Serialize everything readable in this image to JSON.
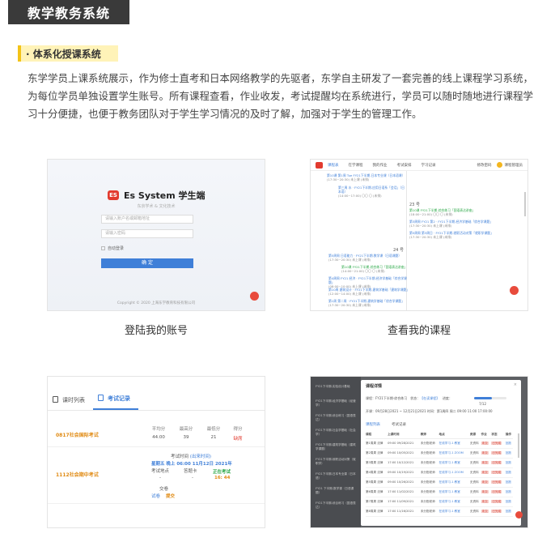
{
  "page": {
    "title": "教学教务系统",
    "section_title": "· 体系化授课系统",
    "intro": "东学学员上课系统展示，作为修士直考和日本网络教学的先驱者，东学自主研发了一套完善的线上课程学习系统，为每位学员单独设置学生账号。所有课程查看，作业收发，考试提醒均在系统进行，学员可以随时随地进行课程学习十分便捷，也便于教务团队对于学生学习情况的及时了解，加强对于学生的管理工作。"
  },
  "captions": {
    "login": "登陆我的账号",
    "course": "查看我的课程"
  },
  "login_shot": {
    "logo_text": "ES",
    "brand": "Es System 学生端",
    "subtitle": "东京学术 & 文化技术",
    "username_placeholder": "请输入账户名或邮箱地址",
    "password_placeholder": "请输入密码",
    "remember": "自动登录",
    "login_button": "确 定",
    "footer": "Copyright © 2020 上海东学教育科技有限公司"
  },
  "course_shot": {
    "nav": [
      "课程表",
      "在学课程",
      "我的作业",
      "考试安排",
      "学习记录"
    ],
    "nav_right": "修改密码",
    "user": "课程管理员",
    "events_left": [
      {
        "title": "第10课 第1周 Tue FY21下半期-日本专业课（日本语课）",
        "time": "(17:30~20:30) 未上课 (未排)"
      },
      {
        "title": "第三周 水 ‧ FY21下半期-应用日语系「会话」（日本语）",
        "time": "(14:00~17:00) 〇〇 〇 (未排)"
      }
    ],
    "day_23": "23 号",
    "events_23": [
      {
        "title": "第10课 FY21下半期-综合练习「国语表达讲座」",
        "time": "(18:00~21:00) 〇〇 〇 (未排)"
      },
      {
        "title": "第3周周 FY21 第2 ‧ FY21下半期-经济学基础「综合学课题」",
        "time": "(17:30~20:30) 未上课 (未排)"
      },
      {
        "title": "第5周周 第3周日 ‧ FY21下半期-就职活动对策「就职学课题」",
        "time": "(17:30~20:30) 未上课 (未排)"
      }
    ],
    "day_24": "24 号",
    "events_24": [
      {
        "title": "第5周周 日语能力 ‧ FY21下半期-数学课（日语课题）",
        "time": "(17:30~20:30) 未上课 (未排)"
      },
      {
        "title": "第10课 FY21下半期-综合练习「国语表达讲座」",
        "time": "(14:00~21:00) 〇〇 〇 (未排)"
      },
      {
        "title": "第4周周 FY21 经济 ‧ FY21下半期-经济学基础「综合学课题」",
        "time": "(08:00~10:00) 未上课 (未排)"
      },
      {
        "title": "第10周 建筑设计 ‧ FY21下半期-建筑学基础「建筑学课题」",
        "time": "(12:00~14:00) 未上课 (未排)"
      },
      {
        "title": "第1周 第二周 ‧ FY21下半期-建筑学基础「综合学课题」",
        "time": "(17:30~20:30) 未上课 (未排)"
      }
    ]
  },
  "records_shot": {
    "tabs": [
      "课时列表",
      "考试记录"
    ],
    "exam1": {
      "name": "0817社会国际考试",
      "avg_label": "平均分",
      "avg": "44.00",
      "max_label": "最高分",
      "max": "39",
      "min_label": "最低分",
      "min": "21",
      "score_label": "得分",
      "score": "缺席"
    },
    "exam2": {
      "name": "1112社会期中考试",
      "time_label": "考试时间",
      "time_status": "(出来时间)",
      "time_value": "星期五 晚上 06:00 11月12日 2021年",
      "place_label": "考试地点",
      "place_value": "-",
      "card_label": "答题卡",
      "card_value": "-",
      "status": "正在考试",
      "countdown": "16: 44",
      "paper_label": "交卷",
      "paper_value": "试卷",
      "submit": "提交"
    }
  },
  "schedule_shot": {
    "sidebar": [
      "FY21下半期-实验设计基础",
      "FY21下半期-经济学基础（经营学）",
      "FY21下半期-综合练习（国语表达）",
      "FY21下半期-社会学基础（社会学）",
      "FY21下半期-建筑学基础（建筑学课题）",
      "FY21下半期-就职活动对策（就职学）",
      "FY21下半期-日本专业课（日本语）",
      "FY21 下半期-数学课（日语课题）",
      "FY21下半期-综合练习（国语表达）"
    ],
    "modal_title": "课程详情",
    "close": "×",
    "info_line1_label": "课程：",
    "info_line1": "FY21下半期-综合练习",
    "info_status_label": "状态：",
    "info_status": "【在读课程】",
    "info_progress_label": "进度：",
    "info_progress": "7/12",
    "info_line2": "开课：09月28日2021 ~ 12月21日2021   时间：第1周四 周二 09:00 11:00 17:00:00",
    "tabs": [
      "课程列表",
      "考试记录"
    ],
    "columns": [
      "课程",
      "上课时间",
      "教师",
      "地点",
      "资源",
      "作业",
      "状态",
      "操作"
    ],
    "rows": [
      {
        "course": "第1周周 法律",
        "time": "09:00 09/28/2021",
        "teacher": "未分配老师",
        "place": "在线学习-1 教室",
        "res": "无资料",
        "hw": "未交",
        "state": "已完成",
        "op": "回放"
      },
      {
        "course": "第2周周 法律",
        "time": "09:00 10/05/2021",
        "teacher": "未分配老师",
        "place": "在线学习-1 ZOOM",
        "res": "无资料",
        "hw": "未交",
        "state": "已完成",
        "op": "回放"
      },
      {
        "course": "第3周周 法律",
        "time": "17:00 10/12/2021",
        "teacher": "未分配老师",
        "place": "在线学习-1 教室",
        "res": "无资料",
        "hw": "未交",
        "state": "已完成",
        "op": "回放"
      },
      {
        "course": "第4周周 法律",
        "time": "09:00 10/19/2021",
        "teacher": "未分配老师",
        "place": "在线学习-1 ZOOM",
        "res": "无资料",
        "hw": "未交",
        "state": "已完成",
        "op": "回放"
      },
      {
        "course": "第5周周 法律",
        "time": "09:00 10/26/2021",
        "teacher": "未分配老师",
        "place": "在线学习-1 教室",
        "res": "无资料",
        "hw": "未交",
        "state": "已完成",
        "op": "回放"
      },
      {
        "course": "第6周周 法律",
        "time": "17:00 11/02/2021",
        "teacher": "未分配老师",
        "place": "在线学习-1 教室",
        "res": "无资料",
        "hw": "未交",
        "state": "已完成",
        "op": "回放"
      },
      {
        "course": "第7周周 法律",
        "time": "17:00 11/09/2021",
        "teacher": "未分配老师",
        "place": "在线学习-1 教室",
        "res": "无资料",
        "hw": "未交",
        "state": "已完成",
        "op": "回放"
      },
      {
        "course": "第8周周 法律",
        "time": "17:00 11/16/2021",
        "teacher": "未分配老师",
        "place": "在线学习-1 教室",
        "res": "无资料",
        "hw": "未交",
        "state": "已完成",
        "op": "回放"
      }
    ]
  }
}
